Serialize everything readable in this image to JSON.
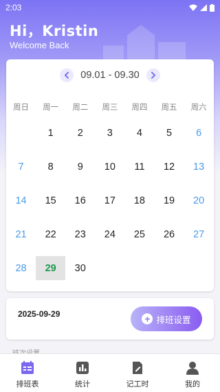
{
  "status_bar": {
    "time": "2:03"
  },
  "header": {
    "greeting": "Hi，Kristin",
    "subtitle": "Welcome Back"
  },
  "calendar": {
    "range": "09.01 - 09.30",
    "weekdays": [
      "周日",
      "周一",
      "周二",
      "周三",
      "周四",
      "周五",
      "周六"
    ],
    "weeks": [
      [
        "",
        "1",
        "2",
        "3",
        "4",
        "5",
        "6"
      ],
      [
        "7",
        "8",
        "9",
        "10",
        "11",
        "12",
        "13"
      ],
      [
        "14",
        "15",
        "16",
        "17",
        "18",
        "19",
        "20"
      ],
      [
        "21",
        "22",
        "23",
        "24",
        "25",
        "26",
        "27"
      ],
      [
        "28",
        "29",
        "30",
        "",
        "",
        "",
        ""
      ]
    ],
    "selected_day": "29",
    "colors": {
      "weekend": "#4a9be8",
      "selected": "#1e9a4f",
      "accent": "#7066ec"
    }
  },
  "info": {
    "selected_date": "2025-09-29",
    "shift_button_label": "排班设置"
  },
  "peek_text": "班次设置",
  "tabs": [
    {
      "label": "排班表",
      "icon": "calendar-icon"
    },
    {
      "label": "统计",
      "icon": "bar-chart-icon"
    },
    {
      "label": "记工时",
      "icon": "edit-note-icon"
    },
    {
      "label": "我的",
      "icon": "person-icon"
    }
  ]
}
